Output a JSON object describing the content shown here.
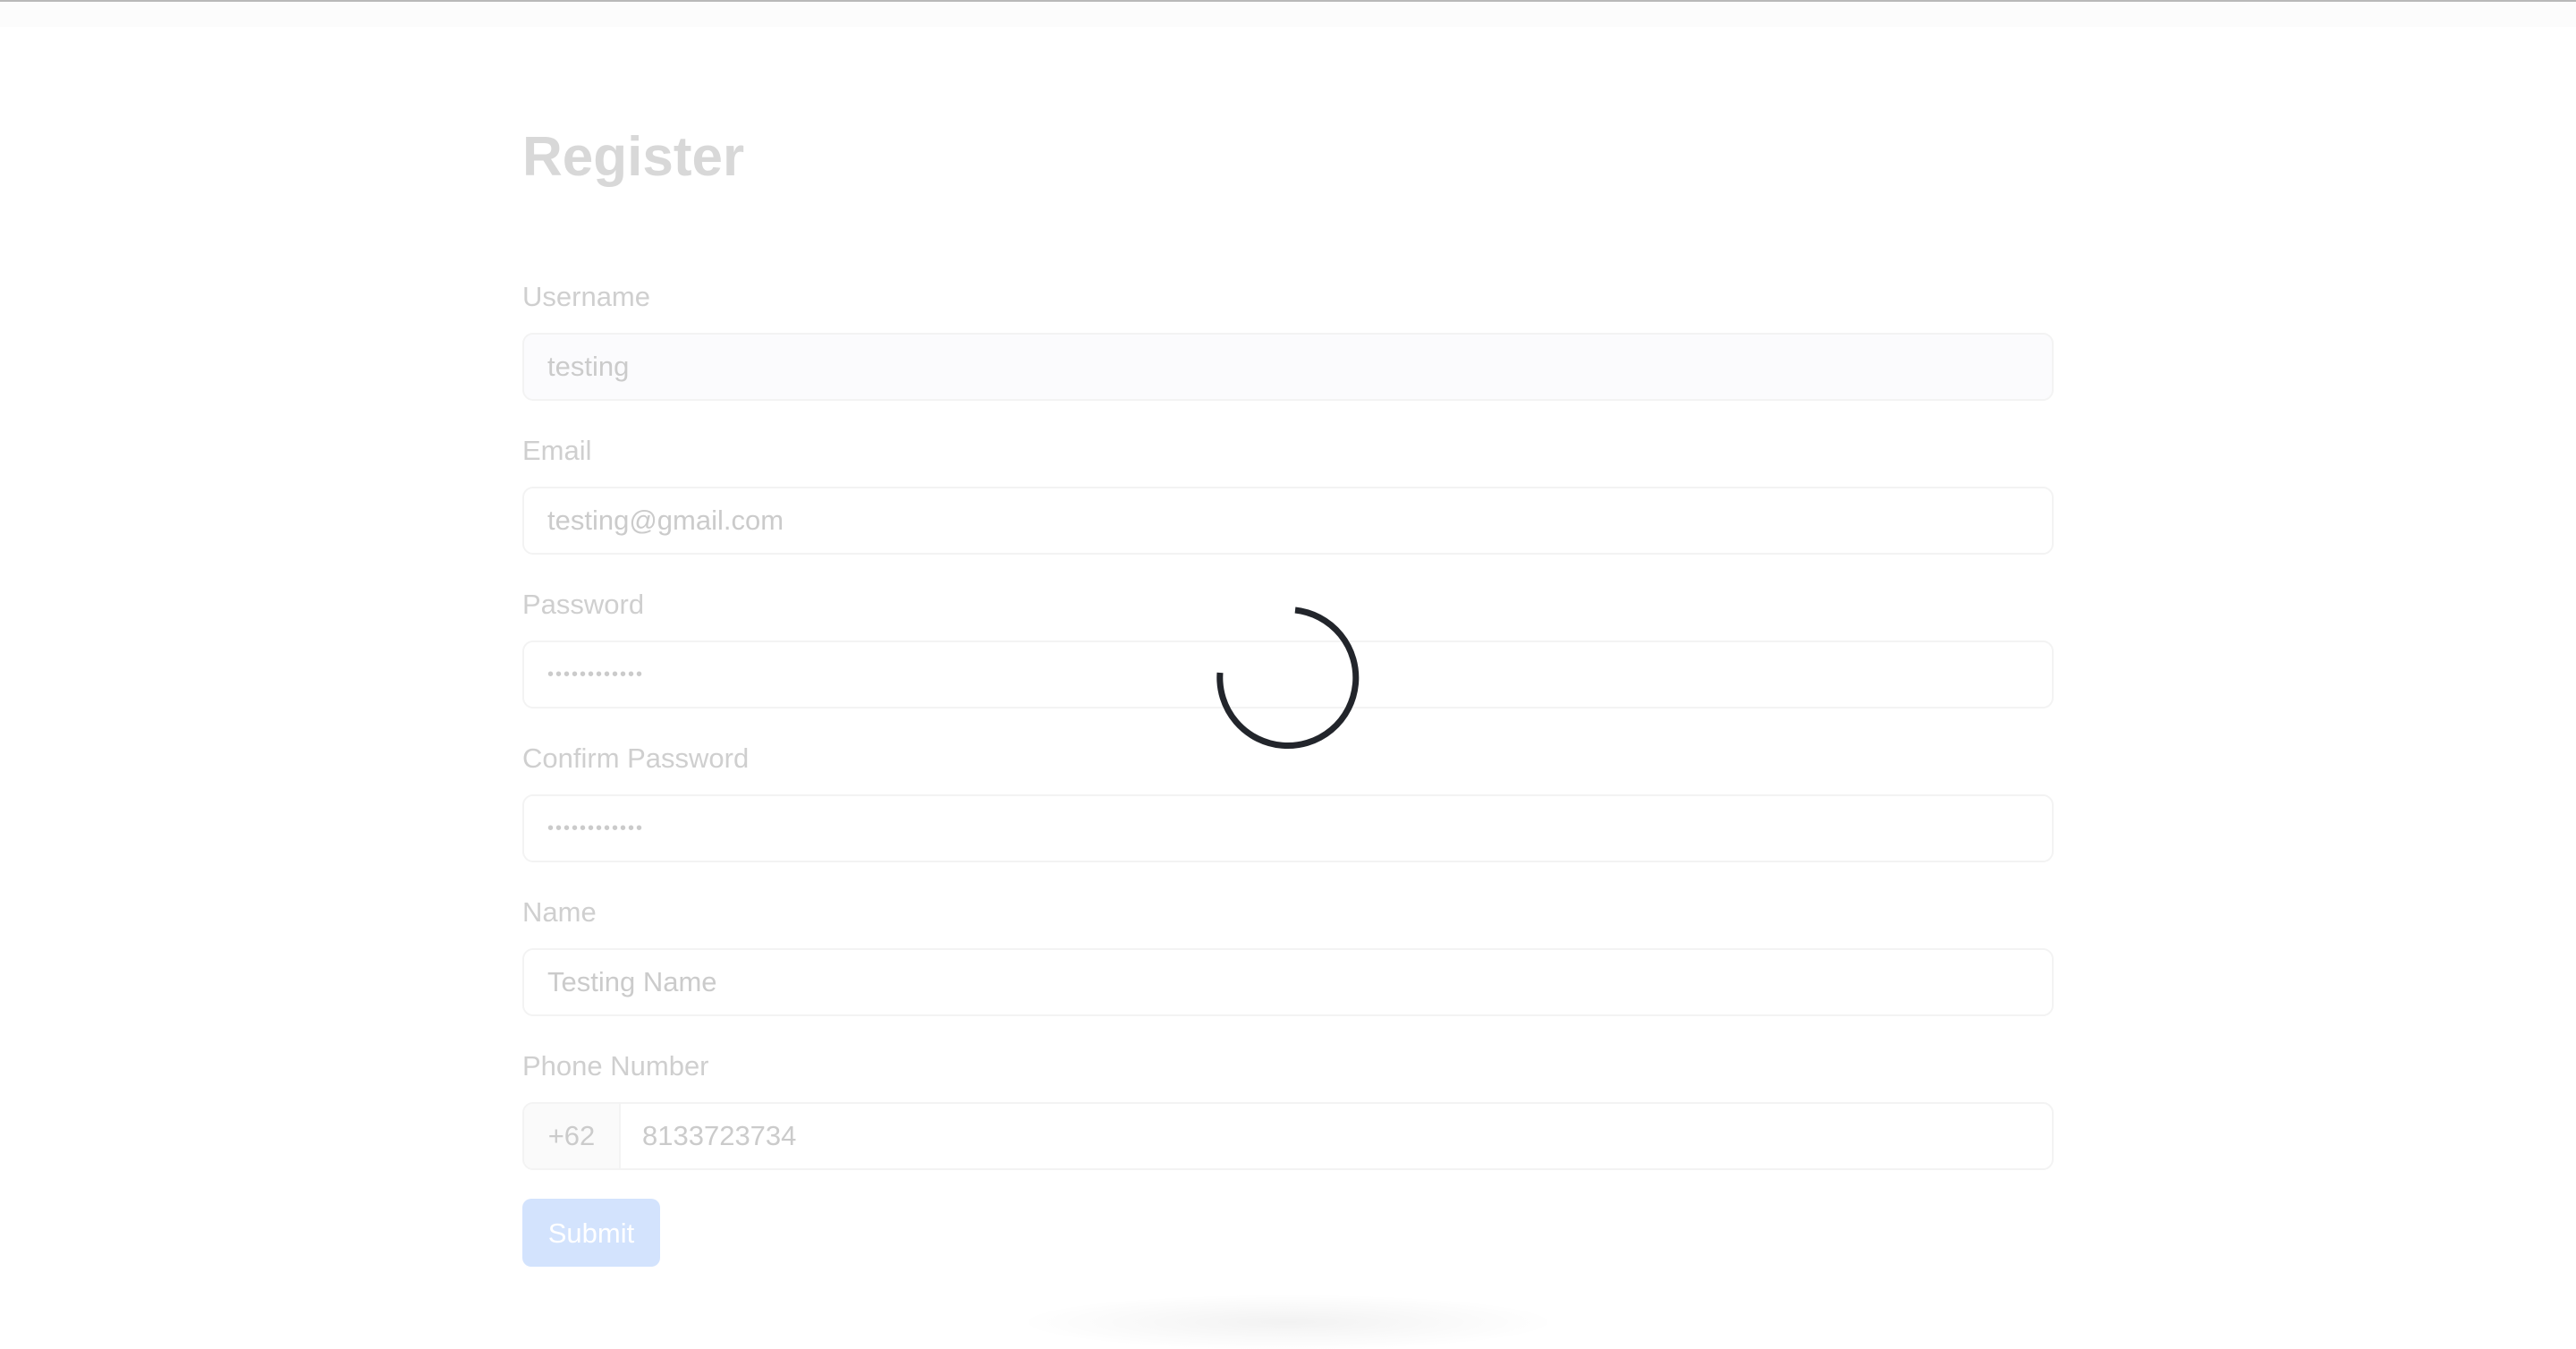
{
  "page": {
    "title": "Register"
  },
  "form": {
    "username": {
      "label": "Username",
      "value": "testing"
    },
    "email": {
      "label": "Email",
      "value": "testing@gmail.com"
    },
    "password": {
      "label": "Password",
      "value": "••••••••••••"
    },
    "confirm_password": {
      "label": "Confirm Password",
      "value": "••••••••••••"
    },
    "name": {
      "label": "Name",
      "value": "Testing Name"
    },
    "phone": {
      "label": "Phone Number",
      "prefix": "+62",
      "value": "8133723734"
    },
    "submit_label": "Submit"
  },
  "loading": {
    "spinner_icon": "loading-spinner-icon"
  },
  "colors": {
    "spinner": "#22252b",
    "submit_background": "#d3e3fd",
    "label_text": "#cfcfcf",
    "title_text": "#d8d8d8"
  }
}
